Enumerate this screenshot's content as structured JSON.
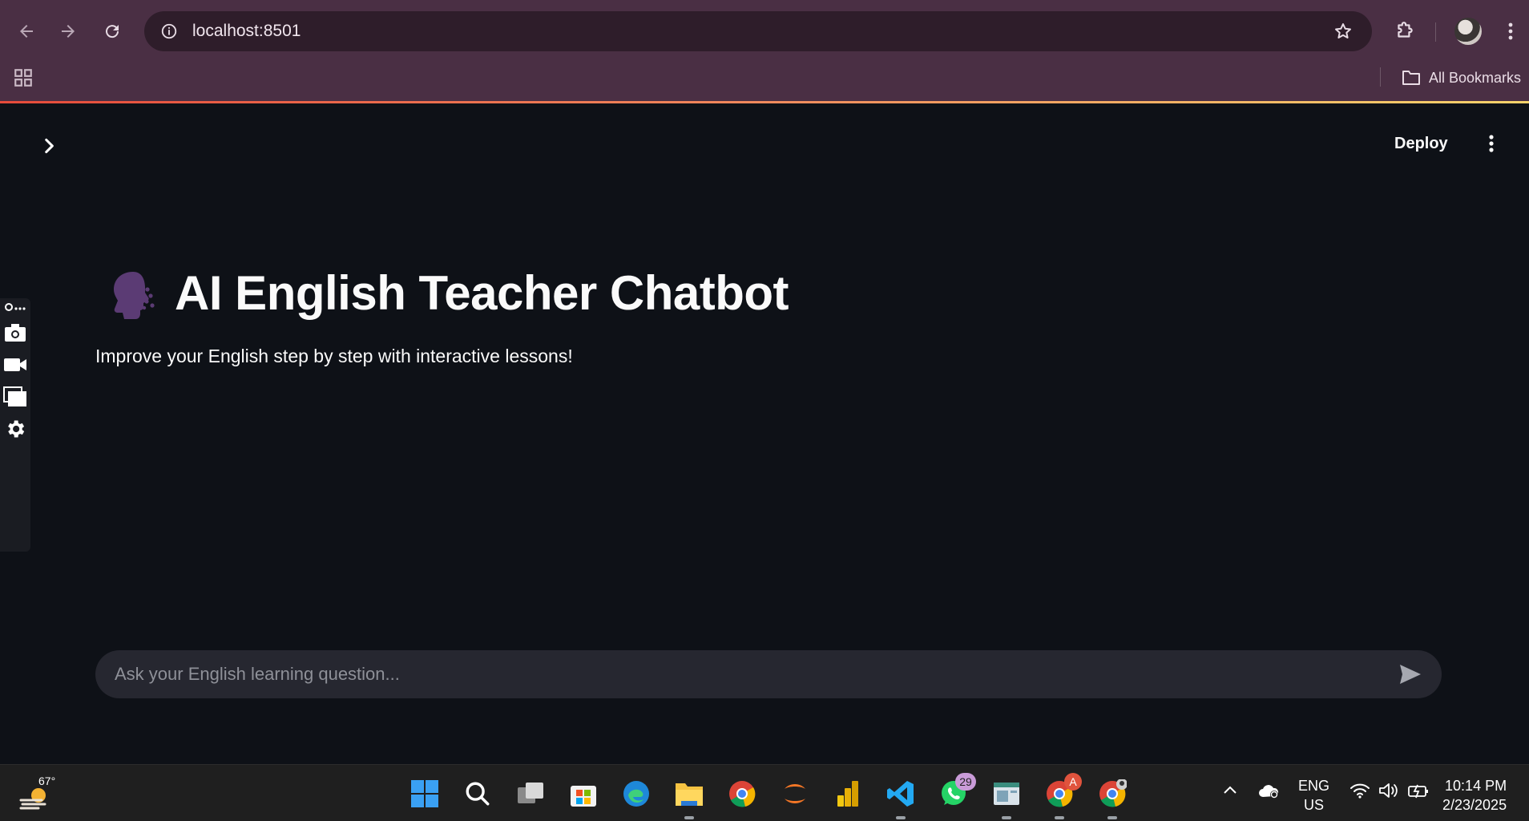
{
  "browser": {
    "url": "localhost:8501",
    "all_bookmarks_label": "All Bookmarks"
  },
  "app": {
    "deploy_label": "Deploy",
    "title": "AI English Teacher Chatbot",
    "subtitle": "Improve your English step by step with interactive lessons!",
    "chat_placeholder": "Ask your English learning question..."
  },
  "taskbar": {
    "temperature": "67°",
    "whatsapp_badge": "29",
    "chrome_badge": "A",
    "language_line1": "ENG",
    "language_line2": "US",
    "time": "10:14 PM",
    "date": "2/23/2025"
  },
  "colors": {
    "browser_frame": "#4a2f44",
    "app_background": "#0e1117",
    "chat_input_bg": "#262730",
    "taskbar_bg": "#1f1f1f"
  }
}
